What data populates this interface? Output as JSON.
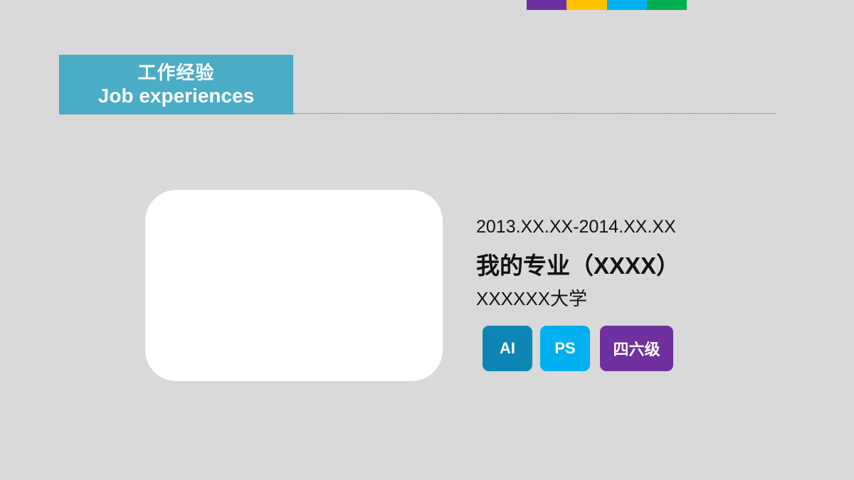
{
  "colors": {
    "background": "#d9d9d9",
    "header_fill": "#4bacc6",
    "photo_fill": "#ffffff",
    "strip": [
      "#7030a0",
      "#ffc000",
      "#00b0f0",
      "#00b050"
    ]
  },
  "header": {
    "title_cn": "工作经验",
    "title_en": "Job experiences"
  },
  "entry": {
    "date_range": "2013.XX.XX-2014.XX.XX",
    "major": "我的专业（XXXX）",
    "school": "XXXXXX大学"
  },
  "skills": [
    {
      "label": "AI",
      "color": "#0e86b5"
    },
    {
      "label": "PS",
      "color": "#00b0f0"
    },
    {
      "label": "四六级",
      "color": "#7030a0"
    }
  ]
}
